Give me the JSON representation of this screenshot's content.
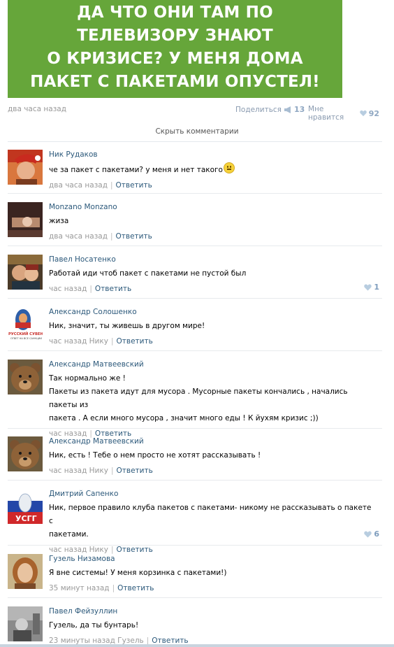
{
  "post": {
    "image_lines": [
      "ДА ЧТО ОНИ ТАМ ПО",
      "ТЕЛЕВИЗОРУ ЗНАЮТ",
      "О КРИЗИСЕ? У МЕНЯ ДОМА",
      "ПАКЕТ С ПАКЕТАМИ ОПУСТЕЛ!"
    ],
    "time": "два часа назад",
    "share_label": "Поделиться",
    "share_count": "13",
    "like_label": "Мне нравится",
    "like_count": "92"
  },
  "hide_comments_label": "Скрыть комментарии",
  "reply_label": "Ответить",
  "comments": [
    {
      "author": "Ник Рудаков",
      "text": "че за пакет с пакетами? у меня и нет такого",
      "time": "два часа назад",
      "likes": ""
    },
    {
      "author": "Monzano Monzano",
      "text": "жиза",
      "time": "два часа назад",
      "likes": ""
    },
    {
      "author": "Павел Носатенко",
      "text": "Работай иди чтоб пакет с пакетами не пустой был",
      "time": "час назад",
      "likes": "1"
    },
    {
      "author": "Александр Солошенко",
      "text": "Ник, значит, ты живешь в другом мире!",
      "time": "час назад Нику",
      "likes": ""
    },
    {
      "author": "Александр Матвеевский",
      "text": "Так нормально же !",
      "text2": "Пакеты из пакета идут для мусора . Мусорные пакеты кончались , начались пакеты из",
      "text3": "пакета . А если много мусора , значит много еды ! К йухям кризис ;))",
      "time": "час назад",
      "likes": ""
    },
    {
      "author": "Александр Матвеевский",
      "text": "Ник, есть ! Тебе о нем просто не хотят рассказывать !",
      "time": "час назад Нику",
      "likes": ""
    },
    {
      "author": "Дмитрий Сапенко",
      "text": "Ник, первое правило клуба пакетов с пакетами- никому не рассказывать о пакете с",
      "text2": "пакетами.",
      "time": "час назад Нику",
      "likes": "6"
    },
    {
      "author": "Гузель Низамова",
      "text": "Я вне системы! У меня корзинка с пакетами!)",
      "time": "35 минут назад",
      "likes": ""
    },
    {
      "author": "Павел Фейзуллин",
      "text": "Гузель, да ты бунтарь!",
      "time": "23 минуты назад Гузель",
      "likes": ""
    }
  ],
  "avatar_texts": {
    "souvenir_title": "РУССКИЙ СУВЕНИР",
    "souvenir_sub": "ОТВЕТ НА ВСЕ САНКЦИИ",
    "ussr": "УСГГ"
  },
  "colors": {
    "post_green": "#66a63a",
    "link_blue": "#2b587a",
    "meta_gray": "#999999",
    "like_blue": "#7e9dbd"
  }
}
